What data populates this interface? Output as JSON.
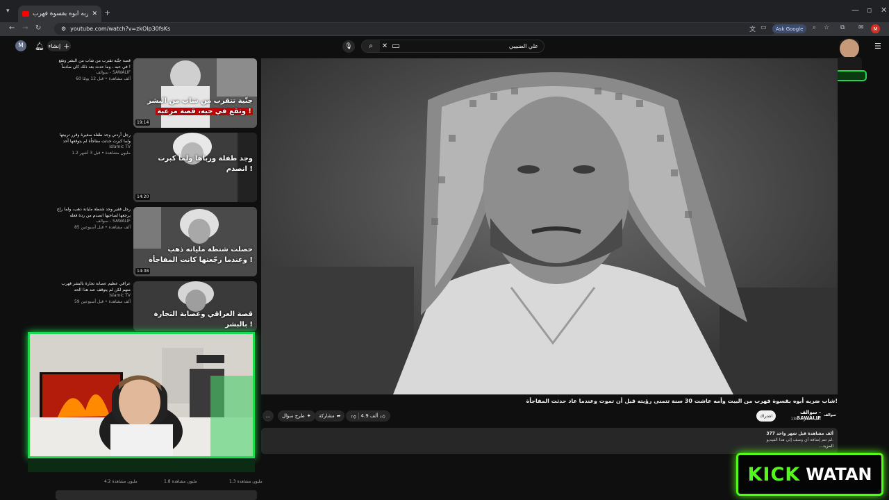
{
  "browser": {
    "tab_title": "شاب ضربه أبوه بقسوة فهرب",
    "url": "youtube.com/watch?v=zkOlp30fsKs",
    "ask_google": "Ask Google",
    "profile_letter": "M"
  },
  "header": {
    "avatar_letter": "M",
    "create_label": "إنشاء",
    "search_query": "علي الضبيبي"
  },
  "video": {
    "title": "شاب ضربه أبوه بقسوة فهرب من البيت وأمه عاشت 30 سنة تتمنى رؤيته قبل أن تموت وعندما عاد حدثت المفاجأة!",
    "channel": "سوالف - SAWALIF",
    "subscribers": "186 ألف مشترك",
    "subscribe_label": "اشتراك",
    "channel_logo_text": "سوالف",
    "likes": "4.9 ألف",
    "share_label": "مشاركة",
    "ask_label": "طرح سؤال",
    "more_label": "...",
    "desc_stats": "377 ألف مشاهدة قبل شهر واحد",
    "desc_line": "لم تتم إضافة أي وصف إلى هذا الفيديو.",
    "desc_more": "...المزيد"
  },
  "recommendations": [
    {
      "meta_title": "قصة جنّية تقترب من شاب من البشر وتقع في حبه ، وما حدث بعد ذلك كان صادماً !",
      "channel": "سوالف - SAWALIF",
      "stats": "60 ألف مشاهدة • قبل 12 يومًا",
      "thumb_line1": "جنّية تتقرب من شاب من البشر",
      "thumb_line2": "وتقع في حبه، قصة مرعبة !",
      "duration": "19:14"
    },
    {
      "meta_title": "رجل أردني وجد طفلة صغيرة وقرر تربيتها ولما كبرت حدثت مفاجأة لم يتوقعها أحد",
      "channel": "Islamic TV",
      "stats": "1.2 مليون مشاهدة • قبل 3 أشهر",
      "thumb_line1": "وجد طفلة ورباها ولما كبرت انصدم !",
      "thumb_line2": "",
      "duration": "14:20"
    },
    {
      "meta_title": "رجل فقير وجد شنطة مليانة ذهب، ولما راح يرجعها لصاحبها انصدم من ردة فعله",
      "channel": "سوالف - SAWALIF",
      "stats": "85 ألف مشاهدة • قبل أسبوعين",
      "thumb_line1": "حصلت شنطة مليانه ذهب",
      "thumb_line2": "وعندما رجّعتها كانت المفاجأة !",
      "duration": "14:08"
    },
    {
      "meta_title": "عراقي عظيم عصابة تجارة بالبشر فهرب منهم لكن لم يتوقف عند هذا الحد",
      "channel": "Islamic TV",
      "stats": "59 ألف مشاهدة • قبل أسبوعين",
      "thumb_line1": "قصة العراقي وعصابة التجارة بالبشر !",
      "thumb_line2": "",
      "duration": ""
    }
  ],
  "bottom_row": [
    "4.2 مليون مشاهدة",
    "1.8 مليون مشاهدة",
    "1.3 مليون مشاهدة"
  ],
  "overlay": {
    "kick": "KICK",
    "watan": "WATAN",
    "kick_color": "#53fc18"
  }
}
